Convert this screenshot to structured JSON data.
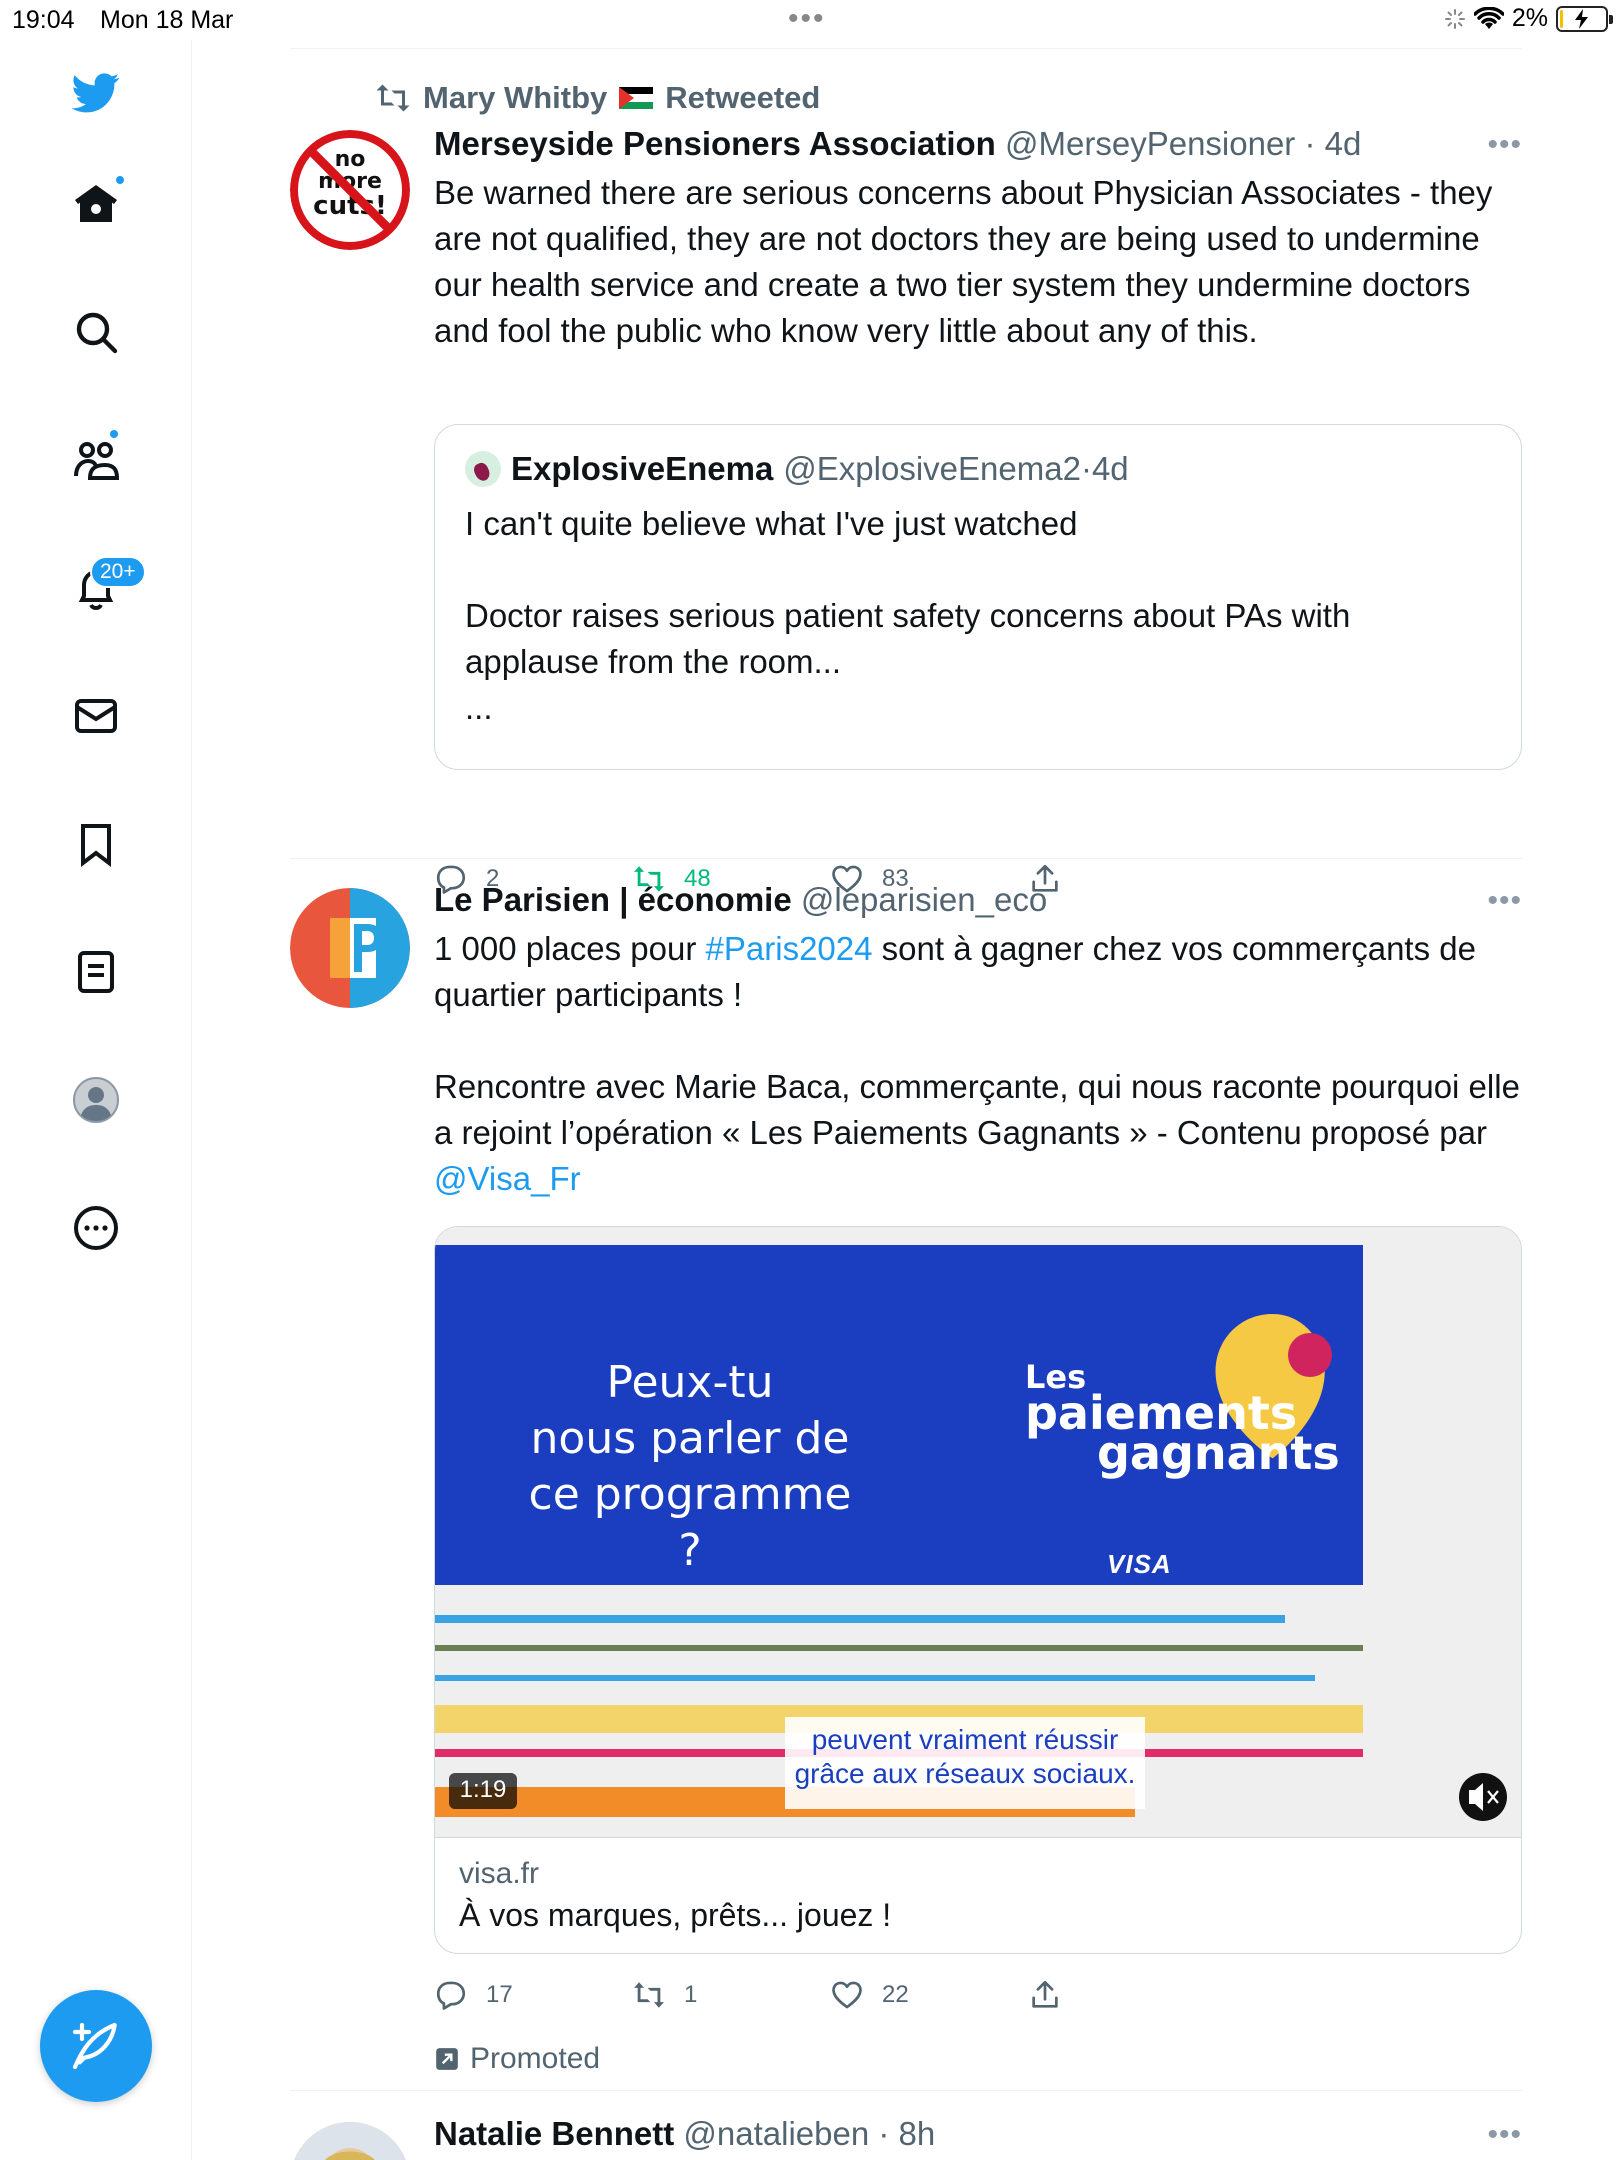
{
  "status_bar": {
    "time": "19:04",
    "date": "Mon 18 Mar",
    "battery": "2%"
  },
  "sidebar": {
    "notifications_badge": "20+",
    "icons": [
      "twitter-bird-icon",
      "home-icon",
      "search-icon",
      "communities-icon",
      "notifications-icon",
      "messages-icon",
      "bookmarks-icon",
      "lists-icon",
      "profile-icon",
      "more-icon"
    ]
  },
  "tweet1": {
    "social_context_name": "Mary Whitby",
    "social_context_suffix": "Retweeted",
    "name": "Merseyside Pensioners Association",
    "handle": "@MerseyPensioner",
    "time": "4d",
    "avatar_text_1": "no",
    "avatar_text_2": "more",
    "avatar_text_3": "cuts!",
    "text": "Be warned there are serious concerns about Physician Associates - they are not qualified, they are not doctors they are being used to undermine our health service and create a two tier system they undermine doctors and fool the public who know very little about any of this.",
    "quote": {
      "name": "ExplosiveEnema",
      "handle": "@ExplosiveEnema2",
      "time": "4d",
      "text": "I can't quite believe what I've just watched\n\nDoctor raises serious patient safety concerns about PAs with applause from the room...\n..."
    },
    "replies": "2",
    "retweets": "48",
    "likes": "83"
  },
  "tweet2": {
    "name": "Le Parisien | économie",
    "handle": "@leparisien_eco",
    "text_part1": "1 000 places pour ",
    "hashtag": "#Paris2024",
    "text_part2": " sont à gagner chez vos commerçants de quartier participants !\n\nRencontre avec Marie Baca, commerçante, qui nous raconte pourquoi elle a rejoint l’opération « Les Paiements Gagnants » - Contenu proposé par ",
    "mention": "@Visa_Fr",
    "video": {
      "headline": "Peux-tu\nnous parler de\nce programme ?",
      "brand_line1": "Les",
      "brand_line2": "paiements",
      "brand_line3": "gagnants",
      "visa_label": "VISA",
      "caption_line1": "peuvent vraiment réussir",
      "caption_line2": "grâce aux réseaux sociaux.",
      "duration": "1:19"
    },
    "card_domain": "visa.fr",
    "card_title": "À vos marques, prêts... jouez !",
    "replies": "17",
    "retweets": "1",
    "likes": "22",
    "promoted_label": "Promoted"
  },
  "tweet3": {
    "name": "Natalie Bennett",
    "handle": "@natalieben",
    "time": "8h"
  },
  "colors": {
    "accent": "#1d9bf0",
    "retweet_active": "#00ba7c",
    "secondary_text": "#536471"
  }
}
